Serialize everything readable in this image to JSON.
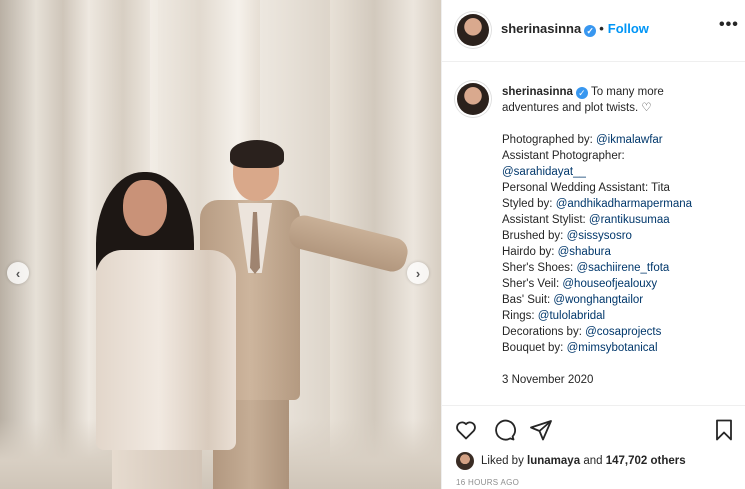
{
  "post": {
    "username": "sherinasinna",
    "verified_mark": "✓",
    "separator": "•",
    "follow_label": "Follow",
    "more_label": "•••",
    "photo_alt": "Wedding photo of a couple in front of white curtains"
  },
  "caption": {
    "username": "sherinasinna",
    "intro_line1": "To many more",
    "intro_line2": "adventures and plot twists. ♡",
    "credits": [
      {
        "label": "Photographed by: ",
        "mention": "@ikmalawfar"
      },
      {
        "label": "Assistant Photographer:",
        "mention": ""
      },
      {
        "label": "",
        "mention": "@sarahidayat__"
      },
      {
        "label": "Personal Wedding Assistant: Tita",
        "mention": ""
      },
      {
        "label": "Styled by: ",
        "mention": "@andhikadharmapermana"
      },
      {
        "label": "Assistant Stylist: ",
        "mention": "@rantikusumaa"
      },
      {
        "label": "Brushed by: ",
        "mention": "@sissysosro"
      },
      {
        "label": "Hairdo by: ",
        "mention": "@shabura"
      },
      {
        "label": "Sher's Shoes: ",
        "mention": "@sachiirene_tfota"
      },
      {
        "label": "Sher's Veil: ",
        "mention": "@houseofjealouxy"
      },
      {
        "label": "Bas' Suit: ",
        "mention": "@wonghangtailor"
      },
      {
        "label": "Rings: ",
        "mention": "@tulolabridal"
      },
      {
        "label": "Decorations by: ",
        "mention": "@cosaprojects"
      },
      {
        "label": "Bouquet by: ",
        "mention": "@mimsybotanical"
      }
    ],
    "date": "3 November 2020"
  },
  "actions": {
    "like_icon": "heart-icon",
    "comment_icon": "comment-icon",
    "share_icon": "paper-plane-icon",
    "save_icon": "bookmark-icon"
  },
  "likes": {
    "prefix": "Liked by ",
    "user": "lunamaya",
    "middle": " and ",
    "count": "147,702 others"
  },
  "time_ago": "16 HOURS AGO",
  "nav": {
    "prev_glyph": "‹",
    "next_glyph": "›"
  },
  "colors": {
    "link": "#0095f6",
    "mention": "#00376b",
    "verified": "#3897f0",
    "muted": "#8e8e8e"
  }
}
